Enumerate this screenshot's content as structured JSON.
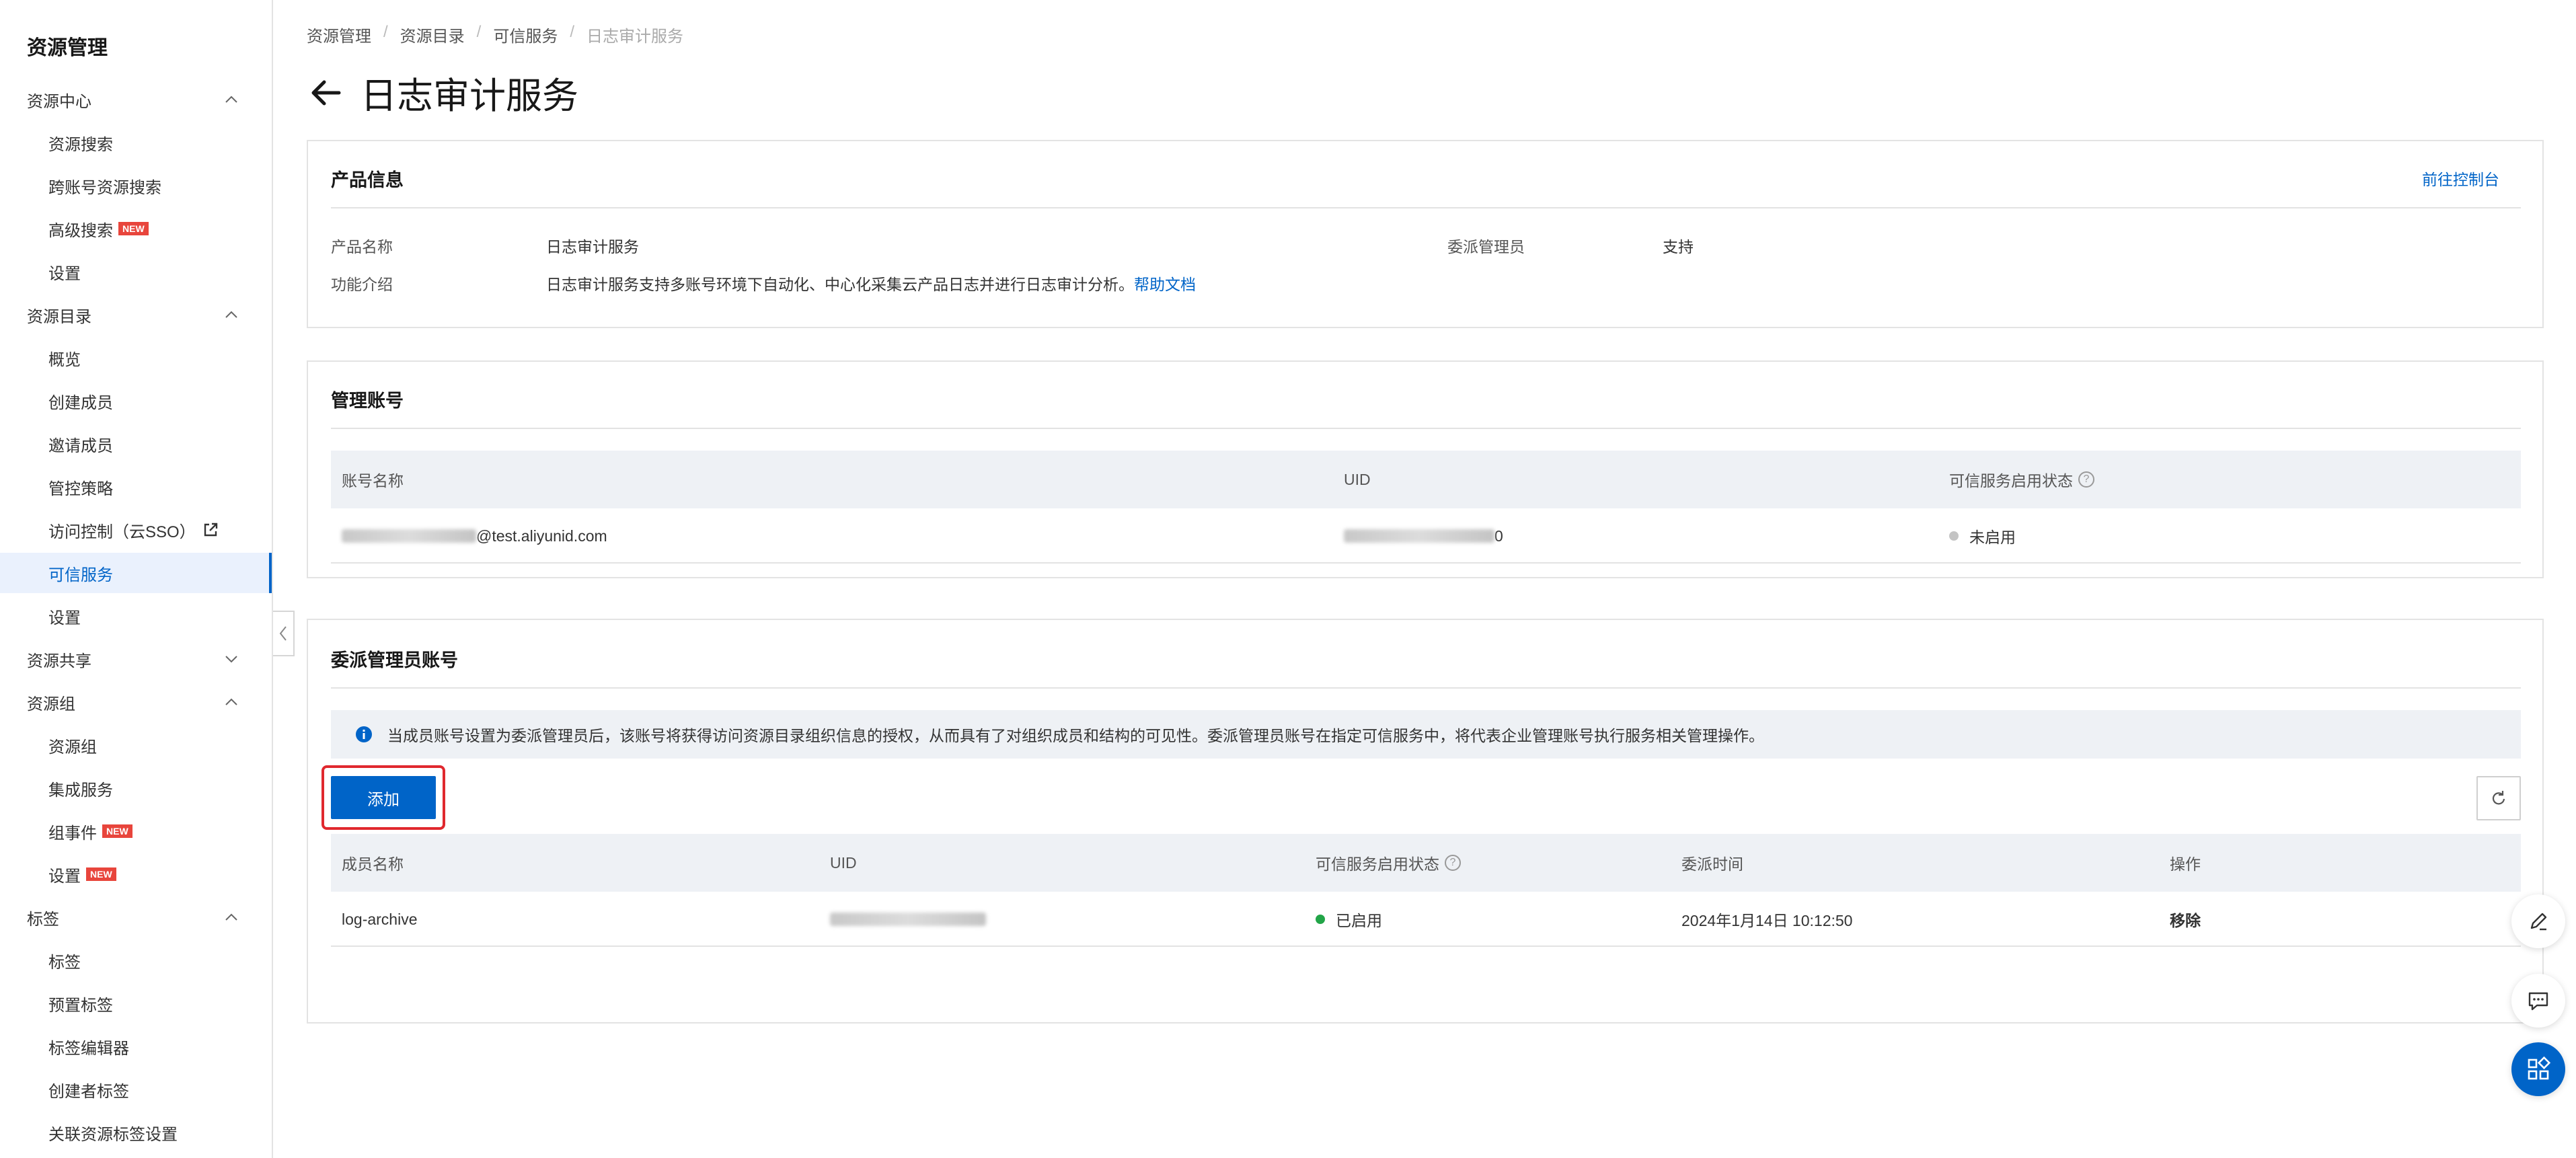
{
  "sidebar": {
    "title": "资源管理",
    "groups": {
      "resource_center": "资源中心",
      "resource_directory": "资源目录",
      "resource_sharing": "资源共享",
      "resource_group": "资源组",
      "tags": "标签"
    },
    "items": {
      "resource_search": "资源搜索",
      "cross_account_search": "跨账号资源搜索",
      "advanced_search": "高级搜索",
      "settings_1": "设置",
      "overview": "概览",
      "create_member": "创建成员",
      "invite_member": "邀请成员",
      "control_policy": "管控策略",
      "access_control": "访问控制（云SSO）",
      "trusted_services": "可信服务",
      "settings_2": "设置",
      "resource_groups": "资源组",
      "integrated_services": "集成服务",
      "group_events": "组事件",
      "settings_3": "设置",
      "tag": "标签",
      "preset_tags": "预置标签",
      "tag_editor": "标签编辑器",
      "creator_tag": "创建者标签",
      "linked_resource_tag_settings": "关联资源标签设置"
    },
    "new_badge": "NEW"
  },
  "breadcrumb": [
    "资源管理",
    "资源目录",
    "可信服务",
    "日志审计服务"
  ],
  "page": {
    "title": "日志审计服务"
  },
  "product_info": {
    "title": "产品信息",
    "console_link": "前往控制台",
    "name_label": "产品名称",
    "name_value": "日志审计服务",
    "delegated_admin_label": "委派管理员",
    "delegated_admin_value": "支持",
    "intro_label": "功能介绍",
    "intro_value": "日志审计服务支持多账号环境下自动化、中心化采集云产品日志并进行日志审计分析。",
    "help_link": "帮助文档"
  },
  "management_account": {
    "title": "管理账号",
    "columns": [
      "账号名称",
      "UID",
      "可信服务启用状态"
    ],
    "row": {
      "account_suffix": "@test.aliyunid.com",
      "uid_suffix": "0",
      "status": "未启用"
    }
  },
  "delegated_admin": {
    "title": "委派管理员账号",
    "notice": "当成员账号设置为委派管理员后，该账号将获得访问资源目录组织信息的授权，从而具有了对组织成员和结构的可见性。委派管理员账号在指定可信服务中，将代表企业管理账号执行服务相关管理操作。",
    "add_button": "添加",
    "columns": [
      "成员名称",
      "UID",
      "可信服务启用状态",
      "委派时间",
      "操作"
    ],
    "rows": [
      {
        "member": "log-archive",
        "status": "已启用",
        "time": "2024年1月14日 10:12:50",
        "action": "移除"
      }
    ]
  },
  "colors": {
    "primary": "#0064c8",
    "enabled": "#22a548",
    "disabled": "#c4c4c4",
    "highlight": "#e0282e"
  }
}
